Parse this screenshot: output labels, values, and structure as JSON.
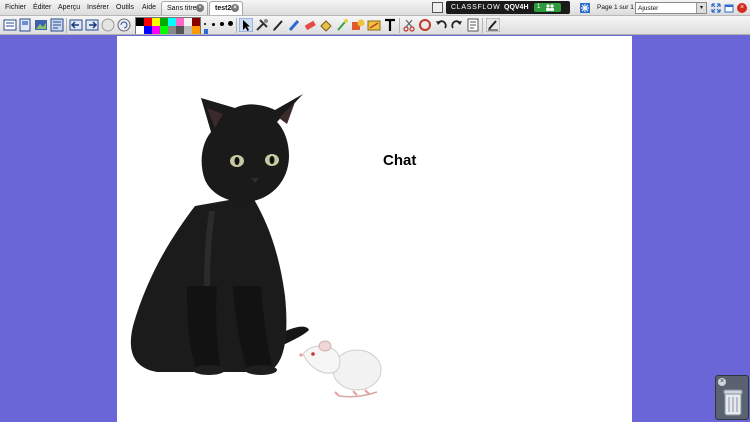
{
  "menu": {
    "items": [
      {
        "label": "Fichier",
        "name": "menu-fichier"
      },
      {
        "label": "Éditer",
        "name": "menu-editer"
      },
      {
        "label": "Aperçu",
        "name": "menu-apercu"
      },
      {
        "label": "Insérer",
        "name": "menu-inserer"
      },
      {
        "label": "Outils",
        "name": "menu-outils"
      },
      {
        "label": "Aide",
        "name": "menu-aide"
      }
    ]
  },
  "tabs": [
    {
      "label": "Sans titre",
      "active": false
    },
    {
      "label": "test2",
      "active": true
    }
  ],
  "classflow": {
    "name": "CLASSFLOW",
    "code": "QQV4H",
    "participants": "1"
  },
  "page_indicator": "Page 1 sur 1",
  "zoom": {
    "value": "Ajuster"
  },
  "palette": {
    "colors": [
      "#000000",
      "#ff0000",
      "#ffff00",
      "#00aa00",
      "#00ffff",
      "#ff66cc",
      "#f4f4f4",
      "#880000",
      "#ffffff",
      "#0000ff",
      "#ff00ff",
      "#00ff00",
      "#888888",
      "#555555",
      "#bbbbbb",
      "#ff9900"
    ]
  },
  "canvas": {
    "background": "#ffffff",
    "side_color": "#6a66d8",
    "label": "Chat"
  },
  "icons": {
    "toolbar": [
      "page-sorter-icon",
      "page-browser-icon",
      "resource-browser-icon",
      "notes-icon",
      "back-icon",
      "forward-icon",
      "undo-circle-icon",
      "flipchart-icon",
      "select-icon",
      "tool-icon",
      "pen-icon",
      "highlighter-icon",
      "eraser-icon",
      "fill-icon",
      "magic-ink-icon",
      "shape-icon",
      "connector-icon",
      "text-icon",
      "scissors-icon",
      "reset-icon",
      "undo-icon",
      "redo-icon",
      "page-icon",
      "desktop-annotate-icon"
    ]
  }
}
